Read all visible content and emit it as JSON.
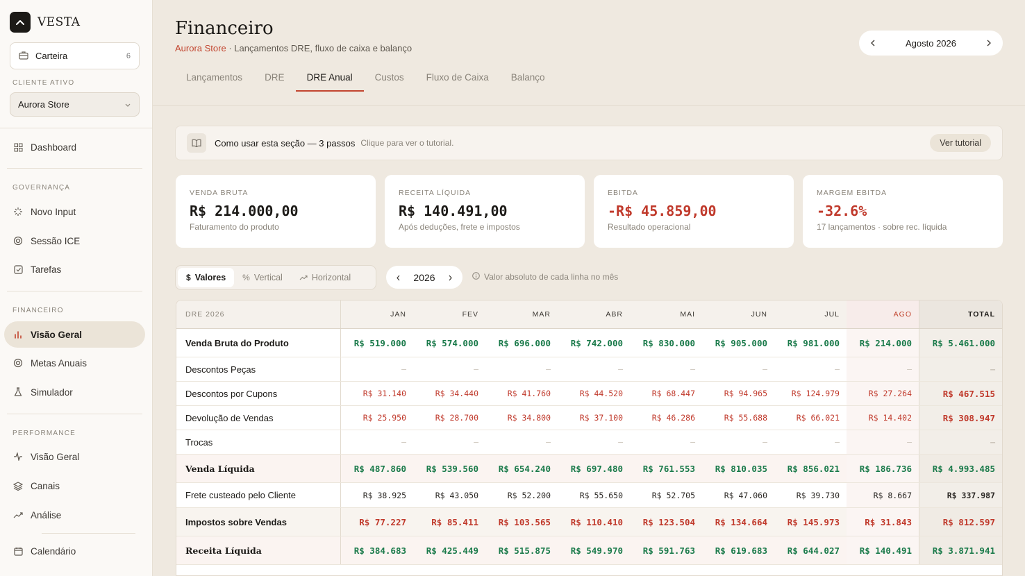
{
  "brand": {
    "name": "VESTA"
  },
  "wallet": {
    "label": "Carteira",
    "count": "6"
  },
  "client": {
    "section_label": "CLIENTE ATIVO",
    "value": "Aurora Store"
  },
  "nav": {
    "dashboard": "Dashboard",
    "sections": {
      "governanca": "GOVERNANÇA",
      "financeiro": "FINANCEIRO",
      "performance": "PERFORMANCE"
    },
    "items": {
      "novo_input": "Novo Input",
      "sessao_ice": "Sessão ICE",
      "tarefas": "Tarefas",
      "visao_geral_fin": "Visão Geral",
      "metas_anuais": "Metas Anuais",
      "simulador": "Simulador",
      "visao_geral_perf": "Visão Geral",
      "canais": "Canais",
      "analise": "Análise",
      "calendario": "Calendário"
    }
  },
  "header": {
    "title": "Financeiro",
    "subtitle_accent": "Aurora Store",
    "subtitle_rest": " · Lançamentos DRE, fluxo de caixa e balanço",
    "month": "Agosto 2026"
  },
  "tabs": [
    "Lançamentos",
    "DRE",
    "DRE Anual",
    "Custos",
    "Fluxo de Caixa",
    "Balanço"
  ],
  "tutorial": {
    "title": "Como usar esta seção — 3 passos",
    "hint": "Clique para ver o tutorial.",
    "button": "Ver tutorial"
  },
  "kpis": [
    {
      "label": "VENDA BRUTA",
      "value": "R$ 214.000,00",
      "sub": "Faturamento do produto",
      "negative": false
    },
    {
      "label": "RECEITA LÍQUIDA",
      "value": "R$ 140.491,00",
      "sub": "Após deduções, frete e impostos",
      "negative": false
    },
    {
      "label": "EBITDA",
      "value": "-R$ 45.859,00",
      "sub": "Resultado operacional",
      "negative": true
    },
    {
      "label": "MARGEM EBITDA",
      "value": "-32.6%",
      "sub": "17 lançamentos · sobre rec. líquida",
      "negative": true
    }
  ],
  "view_toggle": {
    "valores": "Valores",
    "vertical": "Vertical",
    "horizontal": "Horizontal"
  },
  "year": "2026",
  "hint": "Valor absoluto de cada linha no mês",
  "table": {
    "title": "DRE 2026",
    "months": [
      "JAN",
      "FEV",
      "MAR",
      "ABR",
      "MAI",
      "JUN",
      "JUL",
      "AGO"
    ],
    "total_label": "TOTAL",
    "rows": [
      {
        "name": "Venda Bruta do Produto",
        "style": "bold",
        "kind": "pos",
        "values": [
          "R$ 519.000",
          "R$ 574.000",
          "R$ 696.000",
          "R$ 742.000",
          "R$ 830.000",
          "R$ 905.000",
          "R$ 981.000",
          "R$ 214.000"
        ],
        "total": "R$ 5.461.000"
      },
      {
        "name": "Descontos Peças",
        "style": "",
        "kind": "dash",
        "values": [
          "—",
          "—",
          "—",
          "—",
          "—",
          "—",
          "—",
          "—"
        ],
        "total": "—"
      },
      {
        "name": "Descontos por Cupons",
        "style": "",
        "kind": "neg",
        "values": [
          "R$ 31.140",
          "R$ 34.440",
          "R$ 41.760",
          "R$ 44.520",
          "R$ 68.447",
          "R$ 94.965",
          "R$ 124.979",
          "R$ 27.264"
        ],
        "total": "R$ 467.515"
      },
      {
        "name": "Devolução de Vendas",
        "style": "",
        "kind": "neg",
        "values": [
          "R$ 25.950",
          "R$ 28.700",
          "R$ 34.800",
          "R$ 37.100",
          "R$ 46.286",
          "R$ 55.688",
          "R$ 66.021",
          "R$ 14.402"
        ],
        "total": "R$ 308.947"
      },
      {
        "name": "Trocas",
        "style": "",
        "kind": "dash",
        "values": [
          "—",
          "—",
          "—",
          "—",
          "—",
          "—",
          "—",
          "—"
        ],
        "total": "—"
      },
      {
        "name": "Venda Líquida",
        "style": "serif",
        "kind": "pos",
        "values": [
          "R$ 487.860",
          "R$ 539.560",
          "R$ 654.240",
          "R$ 697.480",
          "R$ 761.553",
          "R$ 810.035",
          "R$ 856.021",
          "R$ 186.736"
        ],
        "total": "R$ 4.993.485"
      },
      {
        "name": "Frete custeado pelo Cliente",
        "style": "",
        "kind": "plain",
        "values": [
          "R$ 38.925",
          "R$ 43.050",
          "R$ 52.200",
          "R$ 55.650",
          "R$ 52.705",
          "R$ 47.060",
          "R$ 39.730",
          "R$ 8.667"
        ],
        "total": "R$ 337.987"
      },
      {
        "name": "Impostos sobre Vendas",
        "style": "bold",
        "kind": "negb",
        "values": [
          "R$ 77.227",
          "R$ 85.411",
          "R$ 103.565",
          "R$ 110.410",
          "R$ 123.504",
          "R$ 134.664",
          "R$ 145.973",
          "R$ 31.843"
        ],
        "total": "R$ 812.597"
      },
      {
        "name": "Receita Líquida",
        "style": "serif",
        "kind": "pos",
        "values": [
          "R$ 384.683",
          "R$ 425.449",
          "R$ 515.875",
          "R$ 549.970",
          "R$ 591.763",
          "R$ 619.683",
          "R$ 644.027",
          "R$ 140.491"
        ],
        "total": "R$ 3.871.941"
      }
    ]
  }
}
